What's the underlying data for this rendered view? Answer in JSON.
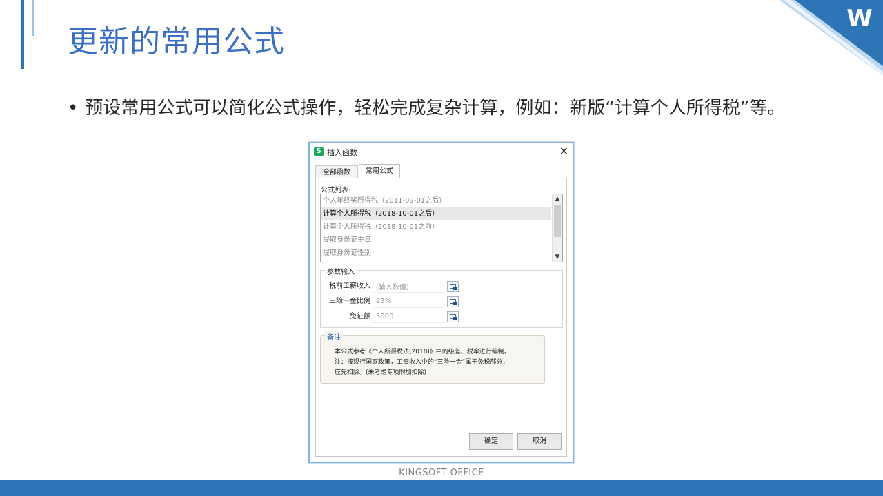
{
  "slide": {
    "title": "更新的常用公式",
    "bullet_char": "•",
    "bullet": "预设常用公式可以简化公式操作，轻松完成复杂计算，例如：新版“计算个人所得税”等。",
    "footer": "KINGSOFT  OFFICE"
  },
  "dialog": {
    "app_icon": "S",
    "title": "插入函数",
    "close": "✕",
    "tabs": [
      {
        "label": "全部函数"
      },
      {
        "label": "常用公式"
      }
    ],
    "list_label": "公式列表:",
    "list_items": [
      {
        "label": "个人年终奖所得税（2011-09-01之后）"
      },
      {
        "label": "计算个人所得税（2018-10-01之后）"
      },
      {
        "label": "计算个人所得税（2018-10-01之前）"
      },
      {
        "label": "提取身份证生日"
      },
      {
        "label": "提取身份证性别"
      }
    ],
    "selected_index": 1,
    "params_legend": "参数输入",
    "params": [
      {
        "label": "税前工薪收入",
        "value": "(输入数值)"
      },
      {
        "label": "三险一金比例",
        "value": "23%"
      },
      {
        "label": "免征额",
        "value": "5000"
      }
    ],
    "notes_legend": "备注",
    "notes": [
      "本公式参考《个人所得税法(2018)》中的级差、税率进行编制。",
      "注：按现行国家政策，工资收入中的“三险一金”属于免税部分，",
      "应先扣除。(未考虑专项附加扣除)"
    ],
    "ok": "确定",
    "cancel": "取消"
  },
  "colors": {
    "title": "#3a6fc4",
    "accent": "#2e75b6",
    "logo": "#1a6fc0"
  },
  "icons": {
    "logo": "wps-logo-icon",
    "param_button": "cell-reference-icon"
  }
}
